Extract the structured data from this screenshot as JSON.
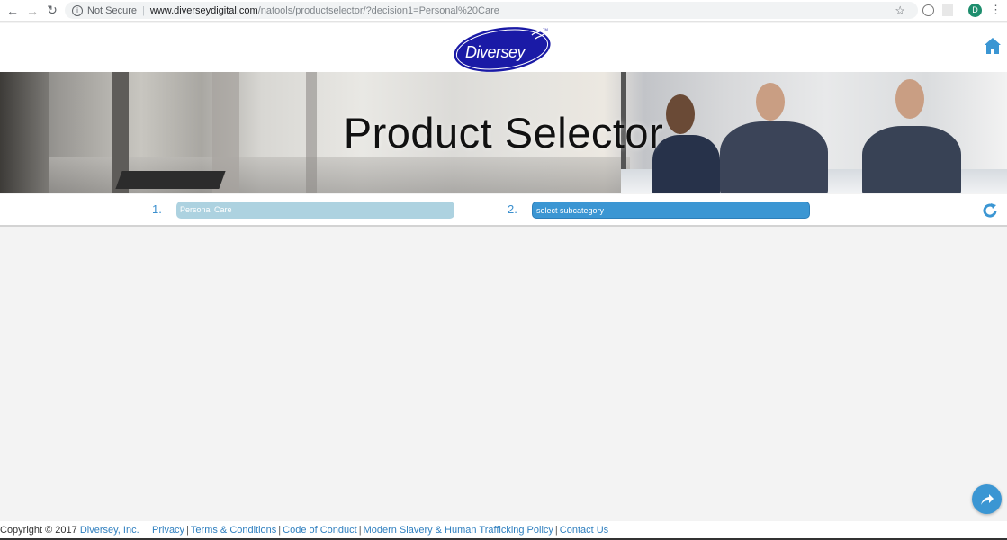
{
  "browser": {
    "security_label": "Not Secure",
    "url_host": "www.diverseydigital.com",
    "url_path": "/natools/productselector/?decision1=Personal%20Care",
    "profile_initial": "D",
    "icons": [
      "back-arrow-icon",
      "forward-arrow-icon",
      "reload-icon",
      "info-icon",
      "star-icon",
      "kebab-menu-icon"
    ]
  },
  "header": {
    "logo_text": "Diversey",
    "logo_tm": "TM",
    "brand_color": "#1a1aa6"
  },
  "banner": {
    "title": "Product Selector"
  },
  "selector": {
    "step1": {
      "number": "1.",
      "value": "Personal Care"
    },
    "step2": {
      "number": "2.",
      "value": "select subcategory"
    },
    "accent_color": "#3b96d3"
  },
  "footer": {
    "copyright": "Copyright © 2017",
    "company": "Diversey, Inc.",
    "links": [
      "Privacy",
      "Terms & Conditions",
      "Code of Conduct",
      "Modern Slavery & Human Trafficking Policy",
      "Contact Us"
    ]
  }
}
